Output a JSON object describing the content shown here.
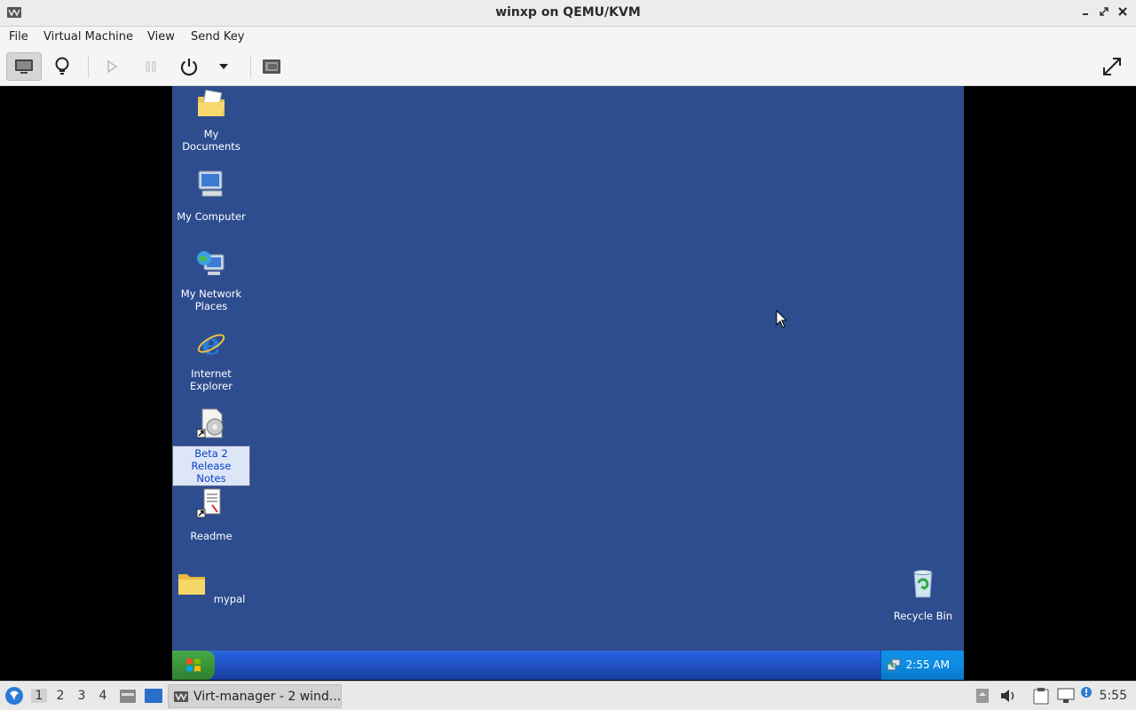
{
  "window": {
    "title": "winxp on QEMU/KVM",
    "app_icon": "virt-manager-icon",
    "controls": [
      "minimize-icon",
      "maximize-icon",
      "close-icon"
    ]
  },
  "menubar": {
    "items": [
      "File",
      "Virtual Machine",
      "View",
      "Send Key"
    ]
  },
  "toolbar": {
    "buttons": [
      "console-icon",
      "details-lightbulb-icon",
      "run-icon",
      "pause-icon",
      "power-icon",
      "dropdown-arrow-icon",
      "snapshots-icon",
      "fullscreen-icon"
    ]
  },
  "guest": {
    "desktop_color": "#2e4d8f",
    "icons": [
      {
        "label_1": "My Documents",
        "label_2": "",
        "icon": "my-documents-icon"
      },
      {
        "label_1": "My Computer",
        "label_2": "",
        "icon": "my-computer-icon"
      },
      {
        "label_1": "My Network",
        "label_2": "Places",
        "icon": "network-places-icon"
      },
      {
        "label_1": "Internet",
        "label_2": "Explorer",
        "icon": "internet-explorer-icon"
      },
      {
        "label_1": "Beta 2 Release",
        "label_2": "Notes",
        "icon": "release-notes-icon",
        "selected": true
      },
      {
        "label_1": "Readme",
        "label_2": "",
        "icon": "readme-icon"
      },
      {
        "label_1": "mypal",
        "label_2": "",
        "icon": "folder-icon"
      },
      {
        "label_1": "Recycle Bin",
        "label_2": "",
        "icon": "recycle-bin-icon"
      }
    ],
    "taskbar": {
      "clock": "2:55 AM"
    }
  },
  "panel": {
    "workspaces": [
      "1",
      "2",
      "3",
      "4"
    ],
    "active_workspace": "1",
    "task_label": "Virt-manager - 2 wind...",
    "clock": "5:55"
  }
}
